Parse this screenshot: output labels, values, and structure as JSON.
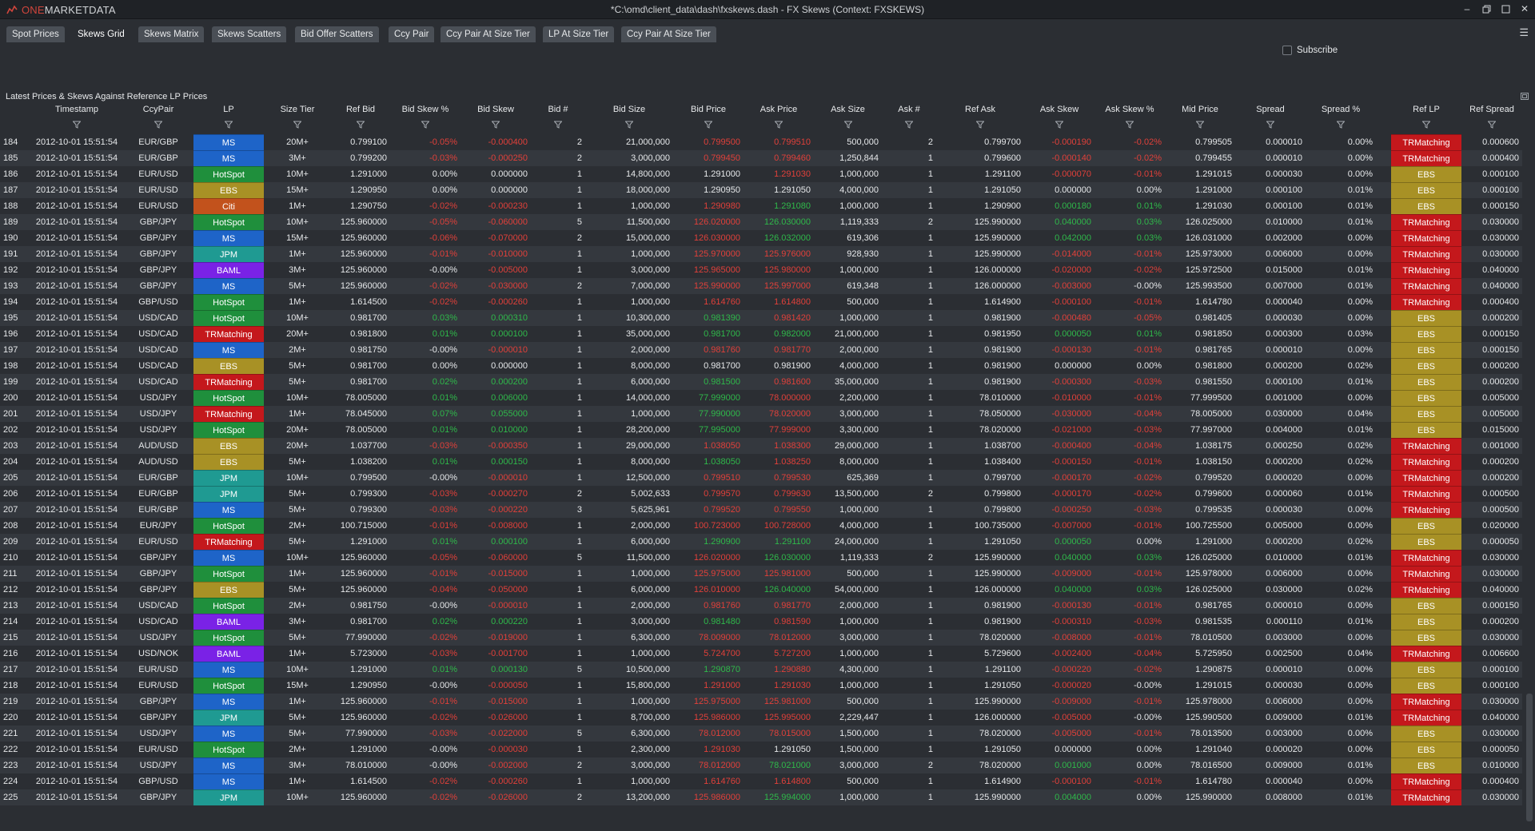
{
  "app": {
    "logo_text_one": "ONE",
    "logo_text_rest": "MARKETDATA",
    "window_title": "*C:\\omd\\client_data\\dash\\fxskews.dash - FX Skews (Context: FXSKEWS)"
  },
  "tabs": [
    {
      "label": "Spot Prices",
      "active": false
    },
    {
      "label": "Skews Grid",
      "active": true
    },
    {
      "label": "Skews Matrix",
      "active": false
    },
    {
      "label": "Skews Scatters",
      "active": false
    },
    {
      "label": "Bid Offer Scatters",
      "active": false
    },
    {
      "label": "Ccy Pair",
      "active": false
    },
    {
      "label": "Ccy Pair At Size Tier",
      "active": false
    },
    {
      "label": "LP At Size Tier",
      "active": false
    },
    {
      "label": "Ccy Pair At Size Tier",
      "active": false
    }
  ],
  "subscribe": {
    "label": "Subscribe",
    "checked": false
  },
  "panel": {
    "title": "Latest Prices & Skews Against Reference LP Prices"
  },
  "colors": {
    "HotSpot": "#1f8f3c",
    "MS": "#1e64c8",
    "EBS": "#a89125",
    "Citi": "#c2521c",
    "JPM": "#1f9a92",
    "BAML": "#7a22e6",
    "TRMatching": "#c4181c",
    "negative": "#e0403a",
    "positive": "#2fb84a"
  },
  "columns": [
    "",
    "Timestamp",
    "CcyPair",
    "LP",
    "Size Tier",
    "Ref Bid",
    "Bid Skew %",
    "Bid Skew",
    "Bid #",
    "Bid Size",
    "Bid Price",
    "Ask Price",
    "Ask Size",
    "Ask #",
    "Ref Ask",
    "Ask Skew",
    "Ask Skew %",
    "Mid Price",
    "Spread",
    "Spread %",
    "Ref LP",
    "Ref Spread"
  ],
  "rows": [
    [
      "184",
      "2012-10-01 15:51:54",
      "EUR/GBP",
      "MS",
      "20M+",
      "0.799100",
      "-0.05%",
      "-0.000400",
      "2",
      "21,000,000",
      "0.799500",
      "0.799510",
      "500,000",
      "2",
      "0.799700",
      "-0.000190",
      "-0.02%",
      "0.799505",
      "0.000010",
      "0.00%",
      "TRMatching",
      "0.000600"
    ],
    [
      "185",
      "2012-10-01 15:51:54",
      "EUR/GBP",
      "MS",
      "3M+",
      "0.799200",
      "-0.03%",
      "-0.000250",
      "2",
      "3,000,000",
      "0.799450",
      "0.799460",
      "1,250,844",
      "1",
      "0.799600",
      "-0.000140",
      "-0.02%",
      "0.799455",
      "0.000010",
      "0.00%",
      "TRMatching",
      "0.000400"
    ],
    [
      "186",
      "2012-10-01 15:51:54",
      "EUR/USD",
      "HotSpot",
      "10M+",
      "1.291000",
      "0.00%",
      "0.000000",
      "1",
      "14,800,000",
      "1.291000",
      "1.291030",
      "1,000,000",
      "1",
      "1.291100",
      "-0.000070",
      "-0.01%",
      "1.291015",
      "0.000030",
      "0.00%",
      "EBS",
      "0.000100"
    ],
    [
      "187",
      "2012-10-01 15:51:54",
      "EUR/USD",
      "EBS",
      "15M+",
      "1.290950",
      "0.00%",
      "0.000000",
      "1",
      "18,000,000",
      "1.290950",
      "1.291050",
      "4,000,000",
      "1",
      "1.291050",
      "0.000000",
      "0.00%",
      "1.291000",
      "0.000100",
      "0.01%",
      "EBS",
      "0.000100"
    ],
    [
      "188",
      "2012-10-01 15:51:54",
      "EUR/USD",
      "Citi",
      "1M+",
      "1.290750",
      "-0.02%",
      "-0.000230",
      "1",
      "1,000,000",
      "1.290980",
      "1.291080",
      "1,000,000",
      "1",
      "1.290900",
      "0.000180",
      "0.01%",
      "1.291030",
      "0.000100",
      "0.01%",
      "EBS",
      "0.000150"
    ],
    [
      "189",
      "2012-10-01 15:51:54",
      "GBP/JPY",
      "HotSpot",
      "10M+",
      "125.960000",
      "-0.05%",
      "-0.060000",
      "5",
      "11,500,000",
      "126.020000",
      "126.030000",
      "1,119,333",
      "2",
      "125.990000",
      "0.040000",
      "0.03%",
      "126.025000",
      "0.010000",
      "0.01%",
      "TRMatching",
      "0.030000"
    ],
    [
      "190",
      "2012-10-01 15:51:54",
      "GBP/JPY",
      "MS",
      "15M+",
      "125.960000",
      "-0.06%",
      "-0.070000",
      "2",
      "15,000,000",
      "126.030000",
      "126.032000",
      "619,306",
      "1",
      "125.990000",
      "0.042000",
      "0.03%",
      "126.031000",
      "0.002000",
      "0.00%",
      "TRMatching",
      "0.030000"
    ],
    [
      "191",
      "2012-10-01 15:51:54",
      "GBP/JPY",
      "JPM",
      "1M+",
      "125.960000",
      "-0.01%",
      "-0.010000",
      "1",
      "1,000,000",
      "125.970000",
      "125.976000",
      "928,930",
      "1",
      "125.990000",
      "-0.014000",
      "-0.01%",
      "125.973000",
      "0.006000",
      "0.00%",
      "TRMatching",
      "0.030000"
    ],
    [
      "192",
      "2012-10-01 15:51:54",
      "GBP/JPY",
      "BAML",
      "3M+",
      "125.960000",
      "-0.00%",
      "-0.005000",
      "1",
      "3,000,000",
      "125.965000",
      "125.980000",
      "1,000,000",
      "1",
      "126.000000",
      "-0.020000",
      "-0.02%",
      "125.972500",
      "0.015000",
      "0.01%",
      "TRMatching",
      "0.040000"
    ],
    [
      "193",
      "2012-10-01 15:51:54",
      "GBP/JPY",
      "MS",
      "5M+",
      "125.960000",
      "-0.02%",
      "-0.030000",
      "2",
      "7,000,000",
      "125.990000",
      "125.997000",
      "619,348",
      "1",
      "126.000000",
      "-0.003000",
      "-0.00%",
      "125.993500",
      "0.007000",
      "0.01%",
      "TRMatching",
      "0.040000"
    ],
    [
      "194",
      "2012-10-01 15:51:54",
      "GBP/USD",
      "HotSpot",
      "1M+",
      "1.614500",
      "-0.02%",
      "-0.000260",
      "1",
      "1,000,000",
      "1.614760",
      "1.614800",
      "500,000",
      "1",
      "1.614900",
      "-0.000100",
      "-0.01%",
      "1.614780",
      "0.000040",
      "0.00%",
      "TRMatching",
      "0.000400"
    ],
    [
      "195",
      "2012-10-01 15:51:54",
      "USD/CAD",
      "HotSpot",
      "10M+",
      "0.981700",
      "0.03%",
      "0.000310",
      "1",
      "10,300,000",
      "0.981390",
      "0.981420",
      "1,000,000",
      "1",
      "0.981900",
      "-0.000480",
      "-0.05%",
      "0.981405",
      "0.000030",
      "0.00%",
      "EBS",
      "0.000200"
    ],
    [
      "196",
      "2012-10-01 15:51:54",
      "USD/CAD",
      "TRMatching",
      "20M+",
      "0.981800",
      "0.01%",
      "0.000100",
      "1",
      "35,000,000",
      "0.981700",
      "0.982000",
      "21,000,000",
      "1",
      "0.981950",
      "0.000050",
      "0.01%",
      "0.981850",
      "0.000300",
      "0.03%",
      "EBS",
      "0.000150"
    ],
    [
      "197",
      "2012-10-01 15:51:54",
      "USD/CAD",
      "MS",
      "2M+",
      "0.981750",
      "-0.00%",
      "-0.000010",
      "1",
      "2,000,000",
      "0.981760",
      "0.981770",
      "2,000,000",
      "1",
      "0.981900",
      "-0.000130",
      "-0.01%",
      "0.981765",
      "0.000010",
      "0.00%",
      "EBS",
      "0.000150"
    ],
    [
      "198",
      "2012-10-01 15:51:54",
      "USD/CAD",
      "EBS",
      "5M+",
      "0.981700",
      "0.00%",
      "0.000000",
      "1",
      "8,000,000",
      "0.981700",
      "0.981900",
      "4,000,000",
      "1",
      "0.981900",
      "0.000000",
      "0.00%",
      "0.981800",
      "0.000200",
      "0.02%",
      "EBS",
      "0.000200"
    ],
    [
      "199",
      "2012-10-01 15:51:54",
      "USD/CAD",
      "TRMatching",
      "5M+",
      "0.981700",
      "0.02%",
      "0.000200",
      "1",
      "6,000,000",
      "0.981500",
      "0.981600",
      "35,000,000",
      "1",
      "0.981900",
      "-0.000300",
      "-0.03%",
      "0.981550",
      "0.000100",
      "0.01%",
      "EBS",
      "0.000200"
    ],
    [
      "200",
      "2012-10-01 15:51:54",
      "USD/JPY",
      "HotSpot",
      "10M+",
      "78.005000",
      "0.01%",
      "0.006000",
      "1",
      "14,000,000",
      "77.999000",
      "78.000000",
      "2,200,000",
      "1",
      "78.010000",
      "-0.010000",
      "-0.01%",
      "77.999500",
      "0.001000",
      "0.00%",
      "EBS",
      "0.005000"
    ],
    [
      "201",
      "2012-10-01 15:51:54",
      "USD/JPY",
      "TRMatching",
      "1M+",
      "78.045000",
      "0.07%",
      "0.055000",
      "1",
      "1,000,000",
      "77.990000",
      "78.020000",
      "3,000,000",
      "1",
      "78.050000",
      "-0.030000",
      "-0.04%",
      "78.005000",
      "0.030000",
      "0.04%",
      "EBS",
      "0.005000"
    ],
    [
      "202",
      "2012-10-01 15:51:54",
      "USD/JPY",
      "HotSpot",
      "20M+",
      "78.005000",
      "0.01%",
      "0.010000",
      "1",
      "28,200,000",
      "77.995000",
      "77.999000",
      "3,300,000",
      "1",
      "78.020000",
      "-0.021000",
      "-0.03%",
      "77.997000",
      "0.004000",
      "0.01%",
      "EBS",
      "0.015000"
    ],
    [
      "203",
      "2012-10-01 15:51:54",
      "AUD/USD",
      "EBS",
      "20M+",
      "1.037700",
      "-0.03%",
      "-0.000350",
      "1",
      "29,000,000",
      "1.038050",
      "1.038300",
      "29,000,000",
      "1",
      "1.038700",
      "-0.000400",
      "-0.04%",
      "1.038175",
      "0.000250",
      "0.02%",
      "TRMatching",
      "0.001000"
    ],
    [
      "204",
      "2012-10-01 15:51:54",
      "AUD/USD",
      "EBS",
      "5M+",
      "1.038200",
      "0.01%",
      "0.000150",
      "1",
      "8,000,000",
      "1.038050",
      "1.038250",
      "8,000,000",
      "1",
      "1.038400",
      "-0.000150",
      "-0.01%",
      "1.038150",
      "0.000200",
      "0.02%",
      "TRMatching",
      "0.000200"
    ],
    [
      "205",
      "2012-10-01 15:51:54",
      "EUR/GBP",
      "JPM",
      "10M+",
      "0.799500",
      "-0.00%",
      "-0.000010",
      "1",
      "12,500,000",
      "0.799510",
      "0.799530",
      "625,369",
      "1",
      "0.799700",
      "-0.000170",
      "-0.02%",
      "0.799520",
      "0.000020",
      "0.00%",
      "TRMatching",
      "0.000200"
    ],
    [
      "206",
      "2012-10-01 15:51:54",
      "EUR/GBP",
      "JPM",
      "5M+",
      "0.799300",
      "-0.03%",
      "-0.000270",
      "2",
      "5,002,633",
      "0.799570",
      "0.799630",
      "13,500,000",
      "2",
      "0.799800",
      "-0.000170",
      "-0.02%",
      "0.799600",
      "0.000060",
      "0.01%",
      "TRMatching",
      "0.000500"
    ],
    [
      "207",
      "2012-10-01 15:51:54",
      "EUR/GBP",
      "MS",
      "5M+",
      "0.799300",
      "-0.03%",
      "-0.000220",
      "3",
      "5,625,961",
      "0.799520",
      "0.799550",
      "1,000,000",
      "1",
      "0.799800",
      "-0.000250",
      "-0.03%",
      "0.799535",
      "0.000030",
      "0.00%",
      "TRMatching",
      "0.000500"
    ],
    [
      "208",
      "2012-10-01 15:51:54",
      "EUR/JPY",
      "HotSpot",
      "2M+",
      "100.715000",
      "-0.01%",
      "-0.008000",
      "1",
      "2,000,000",
      "100.723000",
      "100.728000",
      "4,000,000",
      "1",
      "100.735000",
      "-0.007000",
      "-0.01%",
      "100.725500",
      "0.005000",
      "0.00%",
      "EBS",
      "0.020000"
    ],
    [
      "209",
      "2012-10-01 15:51:54",
      "EUR/USD",
      "TRMatching",
      "5M+",
      "1.291000",
      "0.01%",
      "0.000100",
      "1",
      "6,000,000",
      "1.290900",
      "1.291100",
      "24,000,000",
      "1",
      "1.291050",
      "0.000050",
      "0.00%",
      "1.291000",
      "0.000200",
      "0.02%",
      "EBS",
      "0.000050"
    ],
    [
      "210",
      "2012-10-01 15:51:54",
      "GBP/JPY",
      "MS",
      "10M+",
      "125.960000",
      "-0.05%",
      "-0.060000",
      "5",
      "11,500,000",
      "126.020000",
      "126.030000",
      "1,119,333",
      "2",
      "125.990000",
      "0.040000",
      "0.03%",
      "126.025000",
      "0.010000",
      "0.01%",
      "TRMatching",
      "0.030000"
    ],
    [
      "211",
      "2012-10-01 15:51:54",
      "GBP/JPY",
      "HotSpot",
      "1M+",
      "125.960000",
      "-0.01%",
      "-0.015000",
      "1",
      "1,000,000",
      "125.975000",
      "125.981000",
      "500,000",
      "1",
      "125.990000",
      "-0.009000",
      "-0.01%",
      "125.978000",
      "0.006000",
      "0.00%",
      "TRMatching",
      "0.030000"
    ],
    [
      "212",
      "2012-10-01 15:51:54",
      "GBP/JPY",
      "EBS",
      "5M+",
      "125.960000",
      "-0.04%",
      "-0.050000",
      "1",
      "6,000,000",
      "126.010000",
      "126.040000",
      "54,000,000",
      "1",
      "126.000000",
      "0.040000",
      "0.03%",
      "126.025000",
      "0.030000",
      "0.02%",
      "TRMatching",
      "0.040000"
    ],
    [
      "213",
      "2012-10-01 15:51:54",
      "USD/CAD",
      "HotSpot",
      "2M+",
      "0.981750",
      "-0.00%",
      "-0.000010",
      "1",
      "2,000,000",
      "0.981760",
      "0.981770",
      "2,000,000",
      "1",
      "0.981900",
      "-0.000130",
      "-0.01%",
      "0.981765",
      "0.000010",
      "0.00%",
      "EBS",
      "0.000150"
    ],
    [
      "214",
      "2012-10-01 15:51:54",
      "USD/CAD",
      "BAML",
      "3M+",
      "0.981700",
      "0.02%",
      "0.000220",
      "1",
      "3,000,000",
      "0.981480",
      "0.981590",
      "1,000,000",
      "1",
      "0.981900",
      "-0.000310",
      "-0.03%",
      "0.981535",
      "0.000110",
      "0.01%",
      "EBS",
      "0.000200"
    ],
    [
      "215",
      "2012-10-01 15:51:54",
      "USD/JPY",
      "HotSpot",
      "5M+",
      "77.990000",
      "-0.02%",
      "-0.019000",
      "1",
      "6,300,000",
      "78.009000",
      "78.012000",
      "3,000,000",
      "1",
      "78.020000",
      "-0.008000",
      "-0.01%",
      "78.010500",
      "0.003000",
      "0.00%",
      "EBS",
      "0.030000"
    ],
    [
      "216",
      "2012-10-01 15:51:54",
      "USD/NOK",
      "BAML",
      "1M+",
      "5.723000",
      "-0.03%",
      "-0.001700",
      "1",
      "1,000,000",
      "5.724700",
      "5.727200",
      "1,000,000",
      "1",
      "5.729600",
      "-0.002400",
      "-0.04%",
      "5.725950",
      "0.002500",
      "0.04%",
      "TRMatching",
      "0.006600"
    ],
    [
      "217",
      "2012-10-01 15:51:54",
      "EUR/USD",
      "MS",
      "10M+",
      "1.291000",
      "0.01%",
      "0.000130",
      "5",
      "10,500,000",
      "1.290870",
      "1.290880",
      "4,300,000",
      "1",
      "1.291100",
      "-0.000220",
      "-0.02%",
      "1.290875",
      "0.000010",
      "0.00%",
      "EBS",
      "0.000100"
    ],
    [
      "218",
      "2012-10-01 15:51:54",
      "EUR/USD",
      "HotSpot",
      "15M+",
      "1.290950",
      "-0.00%",
      "-0.000050",
      "1",
      "15,800,000",
      "1.291000",
      "1.291030",
      "1,000,000",
      "1",
      "1.291050",
      "-0.000020",
      "-0.00%",
      "1.291015",
      "0.000030",
      "0.00%",
      "EBS",
      "0.000100"
    ],
    [
      "219",
      "2012-10-01 15:51:54",
      "GBP/JPY",
      "MS",
      "1M+",
      "125.960000",
      "-0.01%",
      "-0.015000",
      "1",
      "1,000,000",
      "125.975000",
      "125.981000",
      "500,000",
      "1",
      "125.990000",
      "-0.009000",
      "-0.01%",
      "125.978000",
      "0.006000",
      "0.00%",
      "TRMatching",
      "0.030000"
    ],
    [
      "220",
      "2012-10-01 15:51:54",
      "GBP/JPY",
      "JPM",
      "5M+",
      "125.960000",
      "-0.02%",
      "-0.026000",
      "1",
      "8,700,000",
      "125.986000",
      "125.995000",
      "2,229,447",
      "1",
      "126.000000",
      "-0.005000",
      "-0.00%",
      "125.990500",
      "0.009000",
      "0.01%",
      "TRMatching",
      "0.040000"
    ],
    [
      "221",
      "2012-10-01 15:51:54",
      "USD/JPY",
      "MS",
      "5M+",
      "77.990000",
      "-0.03%",
      "-0.022000",
      "5",
      "6,300,000",
      "78.012000",
      "78.015000",
      "1,500,000",
      "1",
      "78.020000",
      "-0.005000",
      "-0.01%",
      "78.013500",
      "0.003000",
      "0.00%",
      "EBS",
      "0.030000"
    ],
    [
      "222",
      "2012-10-01 15:51:54",
      "EUR/USD",
      "HotSpot",
      "2M+",
      "1.291000",
      "-0.00%",
      "-0.000030",
      "1",
      "2,300,000",
      "1.291030",
      "1.291050",
      "1,500,000",
      "1",
      "1.291050",
      "0.000000",
      "0.00%",
      "1.291040",
      "0.000020",
      "0.00%",
      "EBS",
      "0.000050"
    ],
    [
      "223",
      "2012-10-01 15:51:54",
      "USD/JPY",
      "MS",
      "3M+",
      "78.010000",
      "-0.00%",
      "-0.002000",
      "2",
      "3,000,000",
      "78.012000",
      "78.021000",
      "3,000,000",
      "2",
      "78.020000",
      "0.001000",
      "0.00%",
      "78.016500",
      "0.009000",
      "0.01%",
      "EBS",
      "0.010000"
    ],
    [
      "224",
      "2012-10-01 15:51:54",
      "GBP/USD",
      "MS",
      "1M+",
      "1.614500",
      "-0.02%",
      "-0.000260",
      "1",
      "1,000,000",
      "1.614760",
      "1.614800",
      "500,000",
      "1",
      "1.614900",
      "-0.000100",
      "-0.01%",
      "1.614780",
      "0.000040",
      "0.00%",
      "TRMatching",
      "0.000400"
    ],
    [
      "225",
      "2012-10-01 15:51:54",
      "GBP/JPY",
      "JPM",
      "10M+",
      "125.960000",
      "-0.02%",
      "-0.026000",
      "2",
      "13,200,000",
      "125.986000",
      "125.994000",
      "1,000,000",
      "1",
      "125.990000",
      "0.004000",
      "0.00%",
      "125.990000",
      "0.008000",
      "0.01%",
      "TRMatching",
      "0.030000"
    ]
  ]
}
